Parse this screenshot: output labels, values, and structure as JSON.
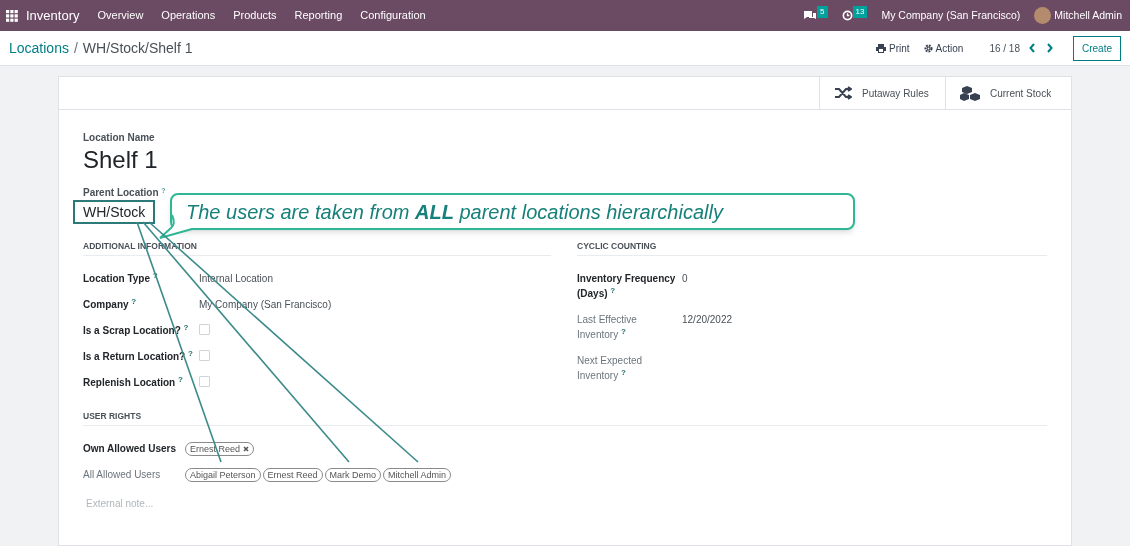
{
  "navbar": {
    "app": "Inventory",
    "menus": [
      "Overview",
      "Operations",
      "Products",
      "Reporting",
      "Configuration"
    ],
    "messages": "5",
    "activities": "13",
    "company": "My Company (San Francisco)",
    "user": "Mitchell Admin"
  },
  "breadcrumb": {
    "parent": "Locations",
    "separator": "/",
    "current": "WH/Stock/Shelf 1"
  },
  "control_panel": {
    "print": "Print",
    "action": "Action",
    "pager": "16 / 18",
    "create": "Create"
  },
  "smart_buttons": [
    "Putaway Rules",
    "Current Stock"
  ],
  "form": {
    "name_label": "Location Name",
    "name": "Shelf 1",
    "parent_label": "Parent Location $^{?}$",
    "parent": "WH/Stock",
    "callout": "The users are taken from **ALL** parent locations hierarchically",
    "additional": {
      "title": "ADDITIONAL INFORMATION",
      "fields": [
        {
          "kind": "text",
          "label": "Location Type $^{?}$",
          "value": "Internal Location",
          "required": true
        },
        {
          "kind": "text",
          "label": "Company $^{?}$",
          "value": "My Company (San Francisco)",
          "required": true
        },
        {
          "kind": "checkbox",
          "label": "Is a Scrap Location? $^{?}$",
          "checked": false,
          "required": true
        },
        {
          "kind": "checkbox",
          "label": "Is a Return Location? $^{?}$",
          "checked": false,
          "required": true
        },
        {
          "kind": "checkbox",
          "label": "Replenish Location $^{?}$",
          "checked": false,
          "required": true
        }
      ]
    },
    "cyclic": {
      "title": "CYCLIC COUNTING",
      "fields": [
        {
          "kind": "text",
          "label": "Inventory Frequency (Days) $^{?}$",
          "value": "0",
          "required": true
        },
        {
          "kind": "text",
          "label": "Last Effective Inventory $^{?}$",
          "value": "12/20/2022",
          "required": false
        },
        {
          "kind": "text",
          "label": "Next Expected Inventory $^{?}$",
          "required": false
        }
      ]
    },
    "user_rights": {
      "title": "USER RIGHTS",
      "rows": [
        {
          "label": "Own Allowed Users",
          "required": true,
          "tags": [
            {
              "name": "Ernest Reed",
              "removable": true
            }
          ]
        },
        {
          "label": "All Allowed Users",
          "required": false,
          "tags": [
            {
              "name": "Abigail Peterson",
              "removable": false
            },
            {
              "name": "Ernest Reed",
              "removable": false
            },
            {
              "name": "Mark Demo",
              "removable": false
            },
            {
              "name": "Mitchell Admin",
              "removable": false
            }
          ]
        }
      ]
    },
    "note_placeholder": "External note..."
  }
}
